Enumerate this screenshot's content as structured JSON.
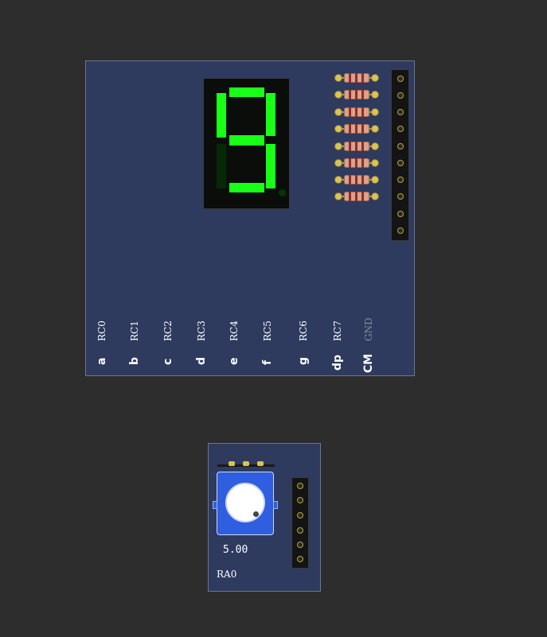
{
  "seven_segment_board": {
    "displayed_digit": "9",
    "segment_pins": [
      {
        "segment": "a",
        "pin": "RC0"
      },
      {
        "segment": "b",
        "pin": "RC1"
      },
      {
        "segment": "c",
        "pin": "RC2"
      },
      {
        "segment": "d",
        "pin": "RC3"
      },
      {
        "segment": "e",
        "pin": "RC4"
      },
      {
        "segment": "f",
        "pin": "RC5"
      },
      {
        "segment": "g",
        "pin": "RC6"
      },
      {
        "segment": "dp",
        "pin": "RC7"
      },
      {
        "segment": "CM",
        "pin": "GND"
      }
    ],
    "segments_on": {
      "a": true,
      "b": true,
      "c": true,
      "d": true,
      "e": false,
      "f": true,
      "g": true,
      "dp": false
    },
    "resistor_count": 8,
    "header_pin_count": 10,
    "colors": {
      "segment_on": "#18ff18",
      "segment_off": "#062806",
      "board": "#2e3a5e"
    }
  },
  "potentiometer_board": {
    "value": "5.00",
    "pin": "RA0",
    "header_pin_count": 6,
    "colors": {
      "body": "#2f5fe0",
      "knob": "#ffffff"
    }
  }
}
